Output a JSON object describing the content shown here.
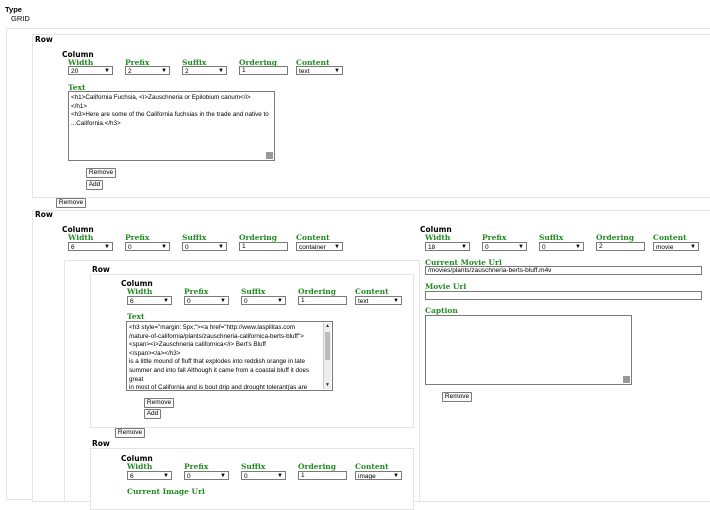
{
  "type_label": "Type",
  "type_value": "GRID",
  "row_label": "Row",
  "column_label": "Column",
  "fields": {
    "width": "Width",
    "prefix": "Prefix",
    "suffix": "Suffix",
    "ordering": "Ordering",
    "content": "Content",
    "text": "Text",
    "current_movie_url": "Current Movie Url",
    "movie_url": "Movie Url",
    "caption": "Caption",
    "current_image_url": "Current Image Url"
  },
  "buttons": {
    "remove": "Remove",
    "add": "Add"
  },
  "row1": {
    "col1": {
      "width": "20",
      "prefix": "2",
      "suffix": "2",
      "ordering": "1",
      "content": "text",
      "text": "<h1>California Fuchsia, <i>Zauschneria or Epilobium canum</i>\n</h1>\n<h3>Here are some of the California fuchsias in the trade and native to ...California.</h3>"
    }
  },
  "row2": {
    "col1": {
      "width": "6",
      "prefix": "0",
      "suffix": "0",
      "ordering": "1",
      "content": "container",
      "nested_row1": {
        "width": "6",
        "prefix": "0",
        "suffix": "0",
        "ordering": "1",
        "content": "text",
        "text": "<h3 style=\"margin: 5px;\"><a href=\"http://www.laspilitas.com\n/nature-of-california/plants/zauschneria-californica-berts-bluff\">\n<span><i>Zauschneria californica</i> Bert's Bluff\n</span></a></h3>\nis a little mound of fluff that explodes into reddish orange in late summer and into fall Although it came from a coastal bluff it does great\nin most of California and is bout drip and drought tolerant(as are many"
      },
      "nested_row2": {
        "width": "6",
        "prefix": "0",
        "suffix": "0",
        "ordering": "1",
        "content": "image"
      }
    },
    "col2": {
      "width": "18",
      "prefix": "0",
      "suffix": "0",
      "ordering": "2",
      "content": "movie",
      "current_movie_url": "/movies/plants/zauschneria-berts-bluff.m4v",
      "movie_url": "",
      "caption": ""
    }
  }
}
